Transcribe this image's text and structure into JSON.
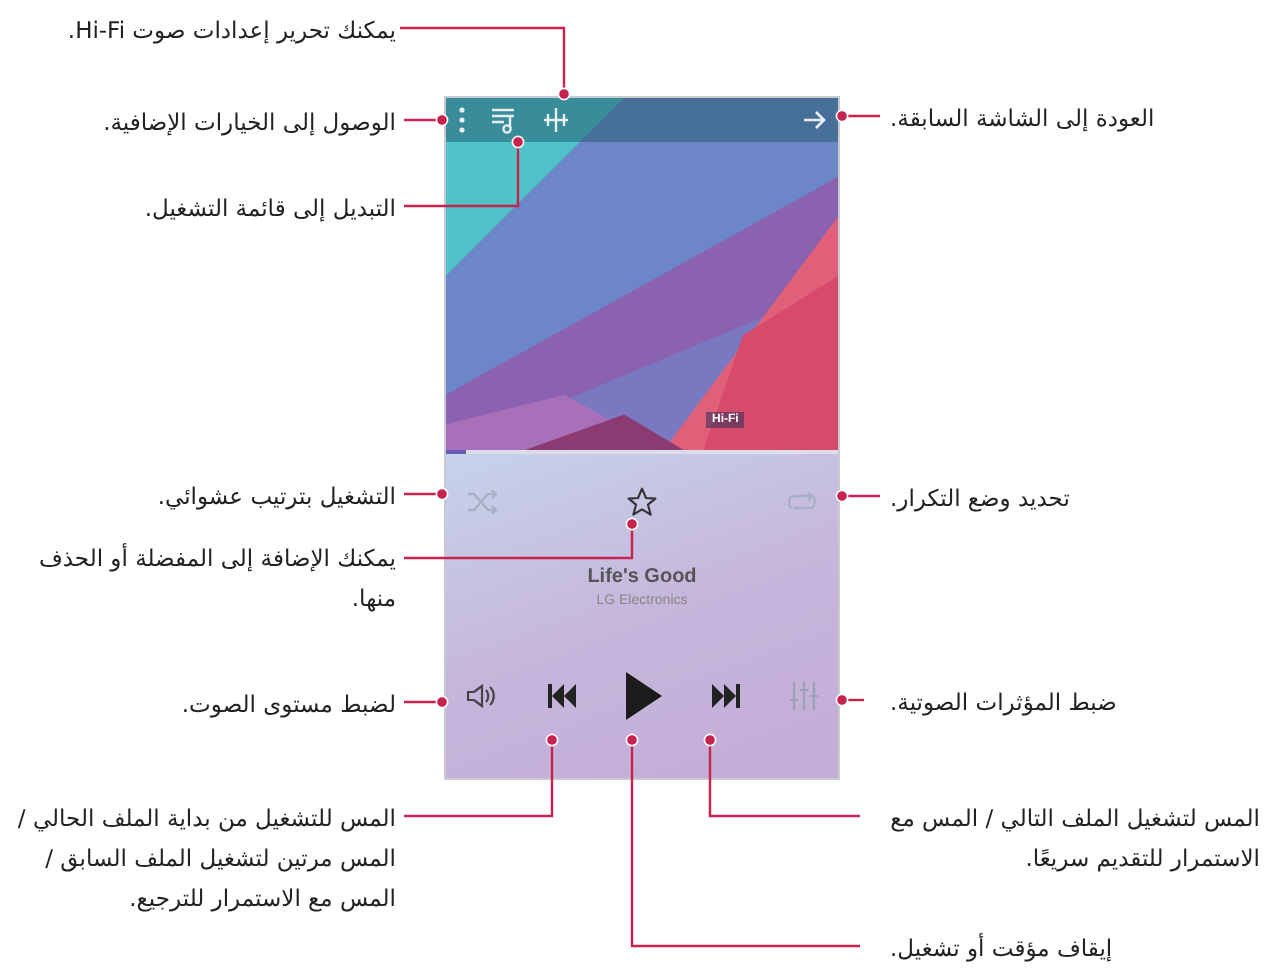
{
  "player": {
    "hifi_badge": "Hi-Fi",
    "progress": {
      "level": 0.05
    },
    "favorite": false,
    "song": {
      "title": "Life's Good",
      "artist": "LG Electronics"
    }
  },
  "callouts": [
    {
      "text": "يمكنك تحرير إعدادات صوت Hi-Fi."
    },
    {
      "text": "الوصول إلى الخيارات الإضافية."
    },
    {
      "text": "التبديل إلى قائمة التشغيل."
    },
    {
      "text": "التشغيل بترتيب عشوائي."
    },
    {
      "text": "يمكنك الإضافة إلى المفضلة أو الحذف منها."
    },
    {
      "text": "لضبط مستوى الصوت."
    },
    {
      "text": "المس للتشغيل من بداية الملف الحالي / المس مرتين لتشغيل الملف السابق / المس مع الاستمرار للترجيع."
    },
    {
      "text": "العودة إلى الشاشة السابقة."
    },
    {
      "text": "تحديد وضع التكرار."
    },
    {
      "text": "ضبط المؤثرات الصوتية."
    },
    {
      "text": "المس لتشغيل الملف التالي / المس مع الاستمرار للتقديم سريعًا."
    },
    {
      "text": "إيقاف مؤقت أو تشغيل."
    }
  ]
}
